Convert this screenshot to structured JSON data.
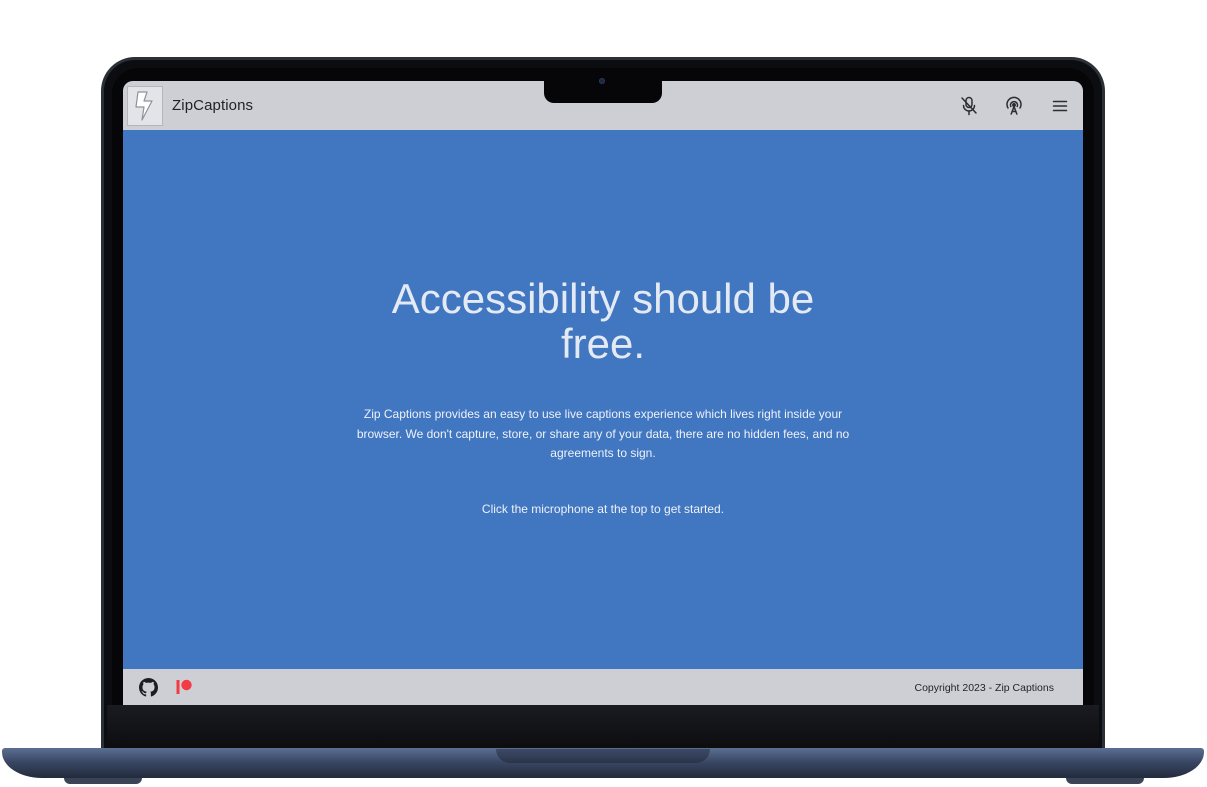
{
  "app": {
    "brand": "ZipCaptions"
  },
  "header": {
    "icons": [
      "microphone-icon",
      "broadcast-icon",
      "menu-icon"
    ]
  },
  "hero": {
    "headline": "Accessibility should be free.",
    "description": "Zip Captions provides an easy to use live captions experience which lives right inside your browser. We don't capture, store, or share any of your data, there are no hidden fees, and no agreements to sign.",
    "cta": "Click the microphone at the top to get started."
  },
  "footer": {
    "icons": [
      "github-icon",
      "patreon-icon"
    ],
    "copyright": "Copyright 2023 - Zip Captions"
  },
  "colors": {
    "hero_bg": "#4176c1",
    "bar_bg": "#cdcfd4",
    "patreon": "#f23b45"
  }
}
